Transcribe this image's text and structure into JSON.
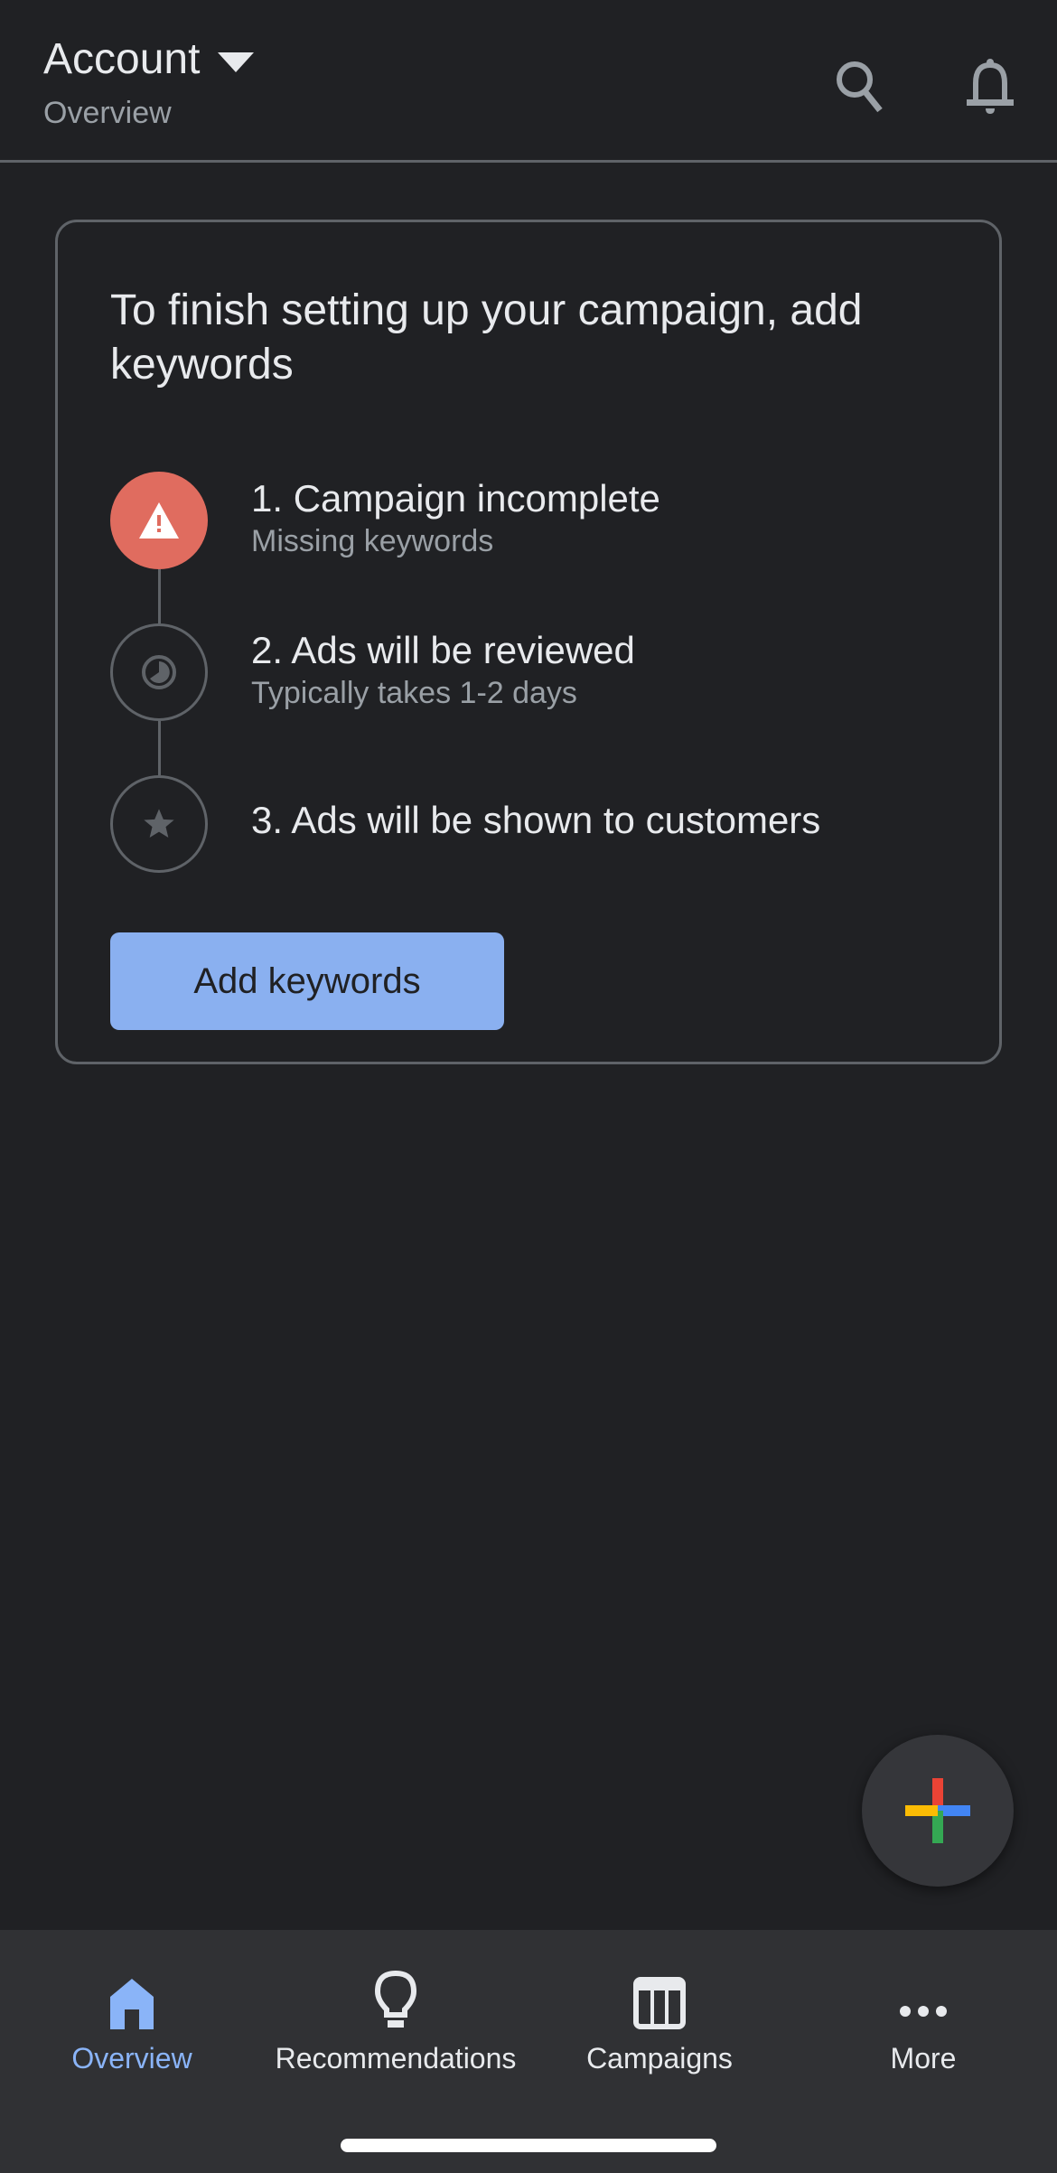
{
  "header": {
    "account_label": "Account",
    "subtitle": "Overview",
    "icons": [
      "search-icon",
      "bell-icon"
    ]
  },
  "card": {
    "title": "To finish setting up your campaign, add keywords",
    "steps": [
      {
        "title": "1. Campaign incomplete",
        "subtitle": "Missing keywords",
        "icon": "warning-icon",
        "status": "error"
      },
      {
        "title": "2. Ads will be reviewed",
        "subtitle": "Typically takes 1-2 days",
        "icon": "clock-icon",
        "status": "pending"
      },
      {
        "title": "3. Ads will be shown to customers",
        "subtitle": "",
        "icon": "star-icon",
        "status": "pending"
      }
    ],
    "button_label": "Add keywords"
  },
  "fab": {
    "icon": "plus-icon",
    "colors": [
      "#ea4335",
      "#4285f4",
      "#34a853",
      "#fbbc04"
    ]
  },
  "bottom_nav": {
    "items": [
      {
        "label": "Overview",
        "icon": "home-icon",
        "active": true
      },
      {
        "label": "Recommendations",
        "icon": "lightbulb-icon",
        "active": false
      },
      {
        "label": "Campaigns",
        "icon": "table-icon",
        "active": false
      },
      {
        "label": "More",
        "icon": "more-icon",
        "active": false
      }
    ]
  },
  "colors": {
    "background": "#202124",
    "accent": "#8ab4f8",
    "error": "#e06c5f",
    "button": "#8ab0f0"
  }
}
